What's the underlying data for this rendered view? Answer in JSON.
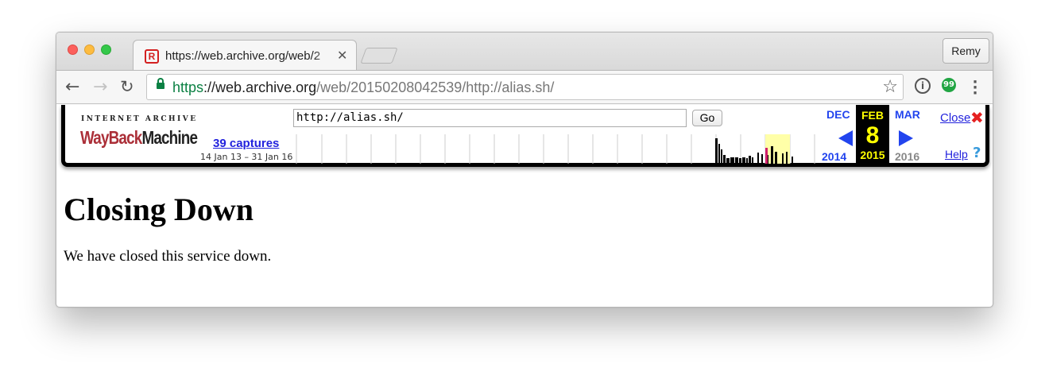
{
  "browser": {
    "tab_title": "https://web.archive.org/web/2",
    "profile_name": "Remy",
    "url": {
      "scheme": "https",
      "separator": "://",
      "host": "web.archive.org",
      "path": "/web/20150208042539/http://alias.sh/"
    }
  },
  "wayback": {
    "logo_top": "INTERNET ARCHIVE",
    "logo_main_red": "WayBack",
    "logo_main_black": "Machine",
    "captures_link": "39 captures",
    "capture_range": "14 Jan 13 – 31 Jan 16",
    "url_input_value": "http://alias.sh/",
    "go_label": "Go",
    "prev_month": "DEC",
    "prev_year": "2014",
    "current_month": "FEB",
    "current_day": "8",
    "current_year": "2015",
    "next_month": "MAR",
    "next_year": "2016",
    "close_label": "Close",
    "help_label": "Help",
    "colors": {
      "link": "#2222dd",
      "arrow": "#2244ee",
      "highlight": "#ffff00",
      "close": "#e52020"
    }
  },
  "page": {
    "heading": "Closing Down",
    "body": "We have closed this service down."
  }
}
